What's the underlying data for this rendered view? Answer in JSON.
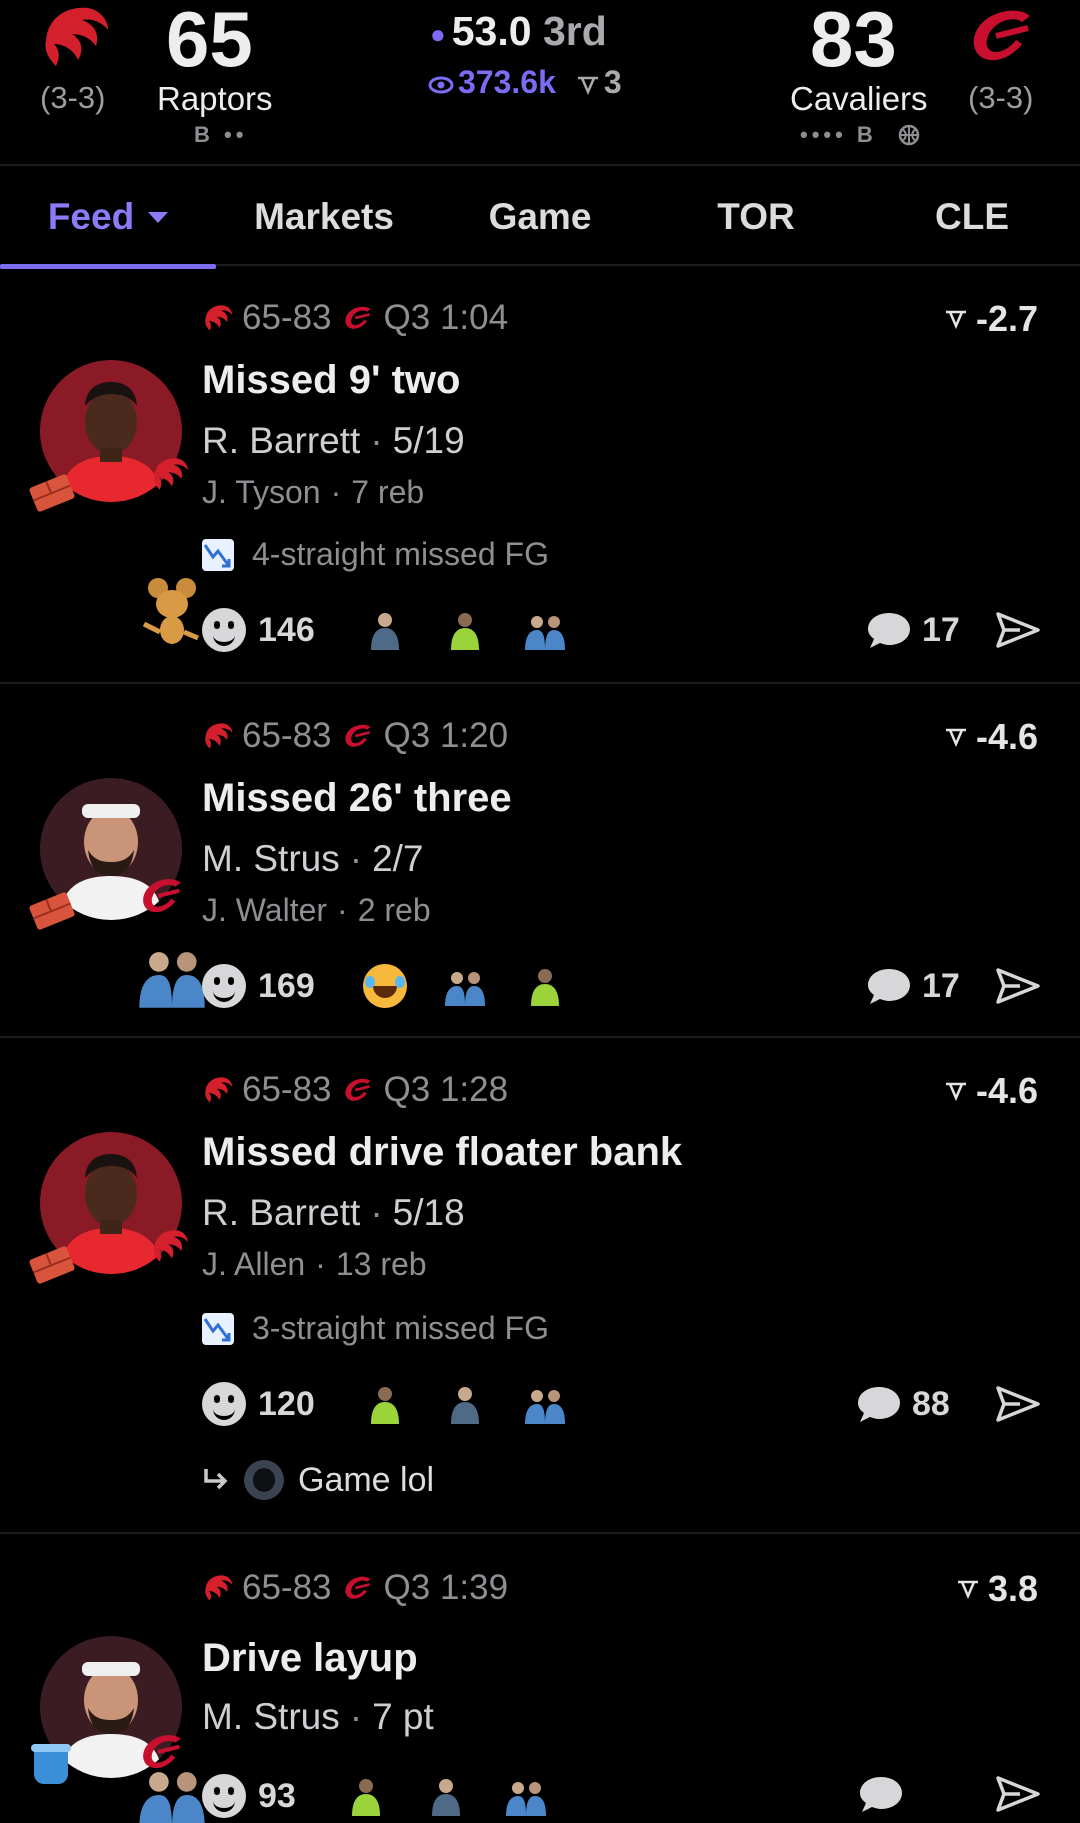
{
  "header": {
    "home": {
      "record": "(3-3)",
      "score": "65",
      "name": "Raptors",
      "dots": "B ••"
    },
    "away": {
      "record": "(3-3)",
      "score": "83",
      "name": "Cavaliers",
      "dots": "•••• B"
    },
    "clock": "53.0",
    "quarter": "3rd",
    "viewers": "373.6k",
    "votes": "3",
    "colors": {
      "accent": "#7c6cf2",
      "raptors": "#ce1141",
      "cavaliers": "#c8102e"
    }
  },
  "tabs": [
    {
      "label": "Feed",
      "active": true
    },
    {
      "label": "Markets"
    },
    {
      "label": "Game"
    },
    {
      "label": "TOR"
    },
    {
      "label": "CLE"
    }
  ],
  "feed": [
    {
      "score": "65-83",
      "time": "Q3 1:04",
      "delta": "-2.7",
      "title": "Missed 9' two",
      "player": "R. Barrett",
      "stat": "5/19",
      "assist": "J. Tyson",
      "assist_stat": "7 reb",
      "streak": "4-straight missed FG",
      "reactions": "146",
      "comments": "17"
    },
    {
      "score": "65-83",
      "time": "Q3 1:20",
      "delta": "-4.6",
      "title": "Missed 26' three",
      "player": "M. Strus",
      "stat": "2/7",
      "assist": "J. Walter",
      "assist_stat": "2 reb",
      "reactions": "169",
      "comments": "17"
    },
    {
      "score": "65-83",
      "time": "Q3 1:28",
      "delta": "-4.6",
      "title": "Missed drive floater bank",
      "player": "R. Barrett",
      "stat": "5/18",
      "assist": "J. Allen",
      "assist_stat": "13 reb",
      "streak": "3-straight missed FG",
      "reactions": "120",
      "comments": "88",
      "reply": "Game lol"
    },
    {
      "score": "65-83",
      "time": "Q3 1:39",
      "delta": "3.8",
      "title": "Drive layup",
      "player": "M. Strus",
      "stat": "7 pt",
      "reactions": "93"
    }
  ]
}
